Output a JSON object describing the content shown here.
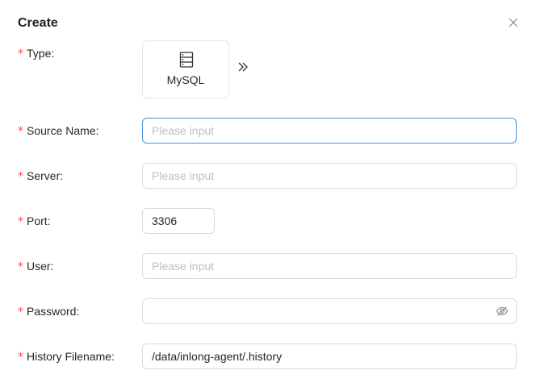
{
  "dialog": {
    "title": "Create"
  },
  "form": {
    "type": {
      "label": "Type",
      "selected": "MySQL",
      "icon": "database-server-icon",
      "more_icon": "double-chevron-right-icon"
    },
    "source_name": {
      "label": "Source Name",
      "value": "",
      "placeholder": "Please input"
    },
    "server": {
      "label": "Server",
      "value": "",
      "placeholder": "Please input"
    },
    "port": {
      "label": "Port",
      "value": "3306",
      "placeholder": ""
    },
    "user": {
      "label": "User",
      "value": "",
      "placeholder": "Please input"
    },
    "password": {
      "label": "Password",
      "value": "",
      "placeholder": "",
      "toggle_icon": "eye-invisible-icon"
    },
    "history_filename": {
      "label": "History Filename",
      "value": "/data/inlong-agent/.history",
      "placeholder": ""
    },
    "required_mark": "*",
    "label_suffix": ":"
  },
  "colors": {
    "required": "#ff4d4f",
    "focus_border": "#4a90e2",
    "border": "#d9d9d9",
    "placeholder": "#bfbfbf"
  }
}
